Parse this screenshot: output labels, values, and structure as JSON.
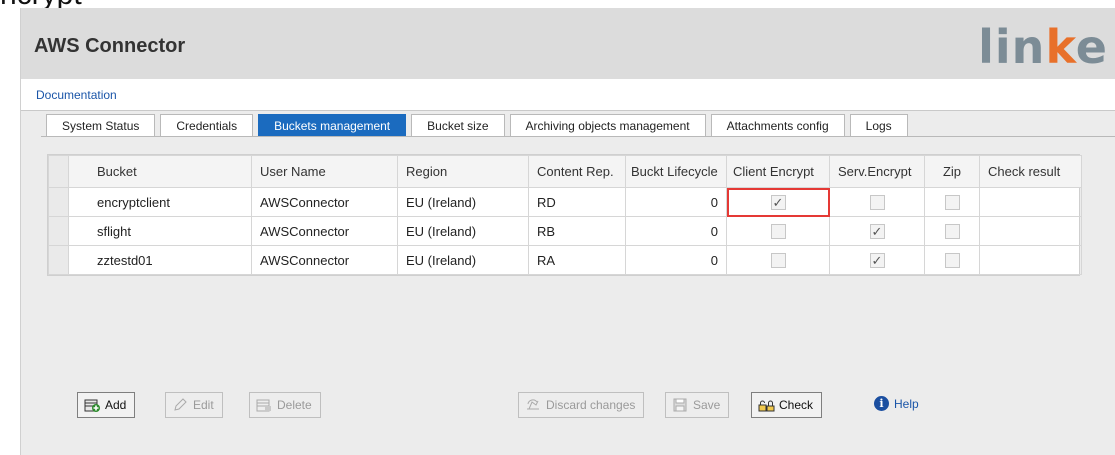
{
  "page_fragment": "ncrypt",
  "app": {
    "title": "AWS Connector",
    "logo_parts": [
      "lin",
      "k",
      "e"
    ]
  },
  "doc_link": "Documentation",
  "tabs": [
    {
      "label": "System Status",
      "active": false
    },
    {
      "label": "Credentials",
      "active": false
    },
    {
      "label": "Buckets management",
      "active": true
    },
    {
      "label": "Bucket size",
      "active": false
    },
    {
      "label": "Archiving objects management",
      "active": false
    },
    {
      "label": "Attachments config",
      "active": false
    },
    {
      "label": "Logs",
      "active": false
    }
  ],
  "table": {
    "headers": [
      "Bucket",
      "User Name",
      "Region",
      "Content Rep.",
      "Buckt Lifecycle",
      "Client Encrypt",
      "Serv.Encrypt",
      "Zip",
      "Check result"
    ],
    "rows": [
      {
        "bucket": "encryptclient",
        "user": "AWSConnector",
        "region": "EU (Ireland)",
        "content_rep": "RD",
        "lifecycle": "0",
        "client_encrypt": true,
        "serv_encrypt": false,
        "zip": false,
        "check_result": ""
      },
      {
        "bucket": "sflight",
        "user": "AWSConnector",
        "region": "EU (Ireland)",
        "content_rep": "RB",
        "lifecycle": "0",
        "client_encrypt": false,
        "serv_encrypt": true,
        "zip": false,
        "check_result": ""
      },
      {
        "bucket": "zztestd01",
        "user": "AWSConnector",
        "region": "EU (Ireland)",
        "content_rep": "RA",
        "lifecycle": "0",
        "client_encrypt": false,
        "serv_encrypt": true,
        "zip": false,
        "check_result": ""
      }
    ]
  },
  "buttons": {
    "add": "Add",
    "edit": "Edit",
    "delete": "Delete",
    "discard": "Discard changes",
    "save": "Save",
    "check": "Check",
    "help": "Help"
  },
  "colors": {
    "active_tab": "#1b6bbf",
    "link": "#1a55a8",
    "highlight": "#e53935",
    "logo_grey": "#7c8c96",
    "logo_orange": "#e8702a"
  }
}
